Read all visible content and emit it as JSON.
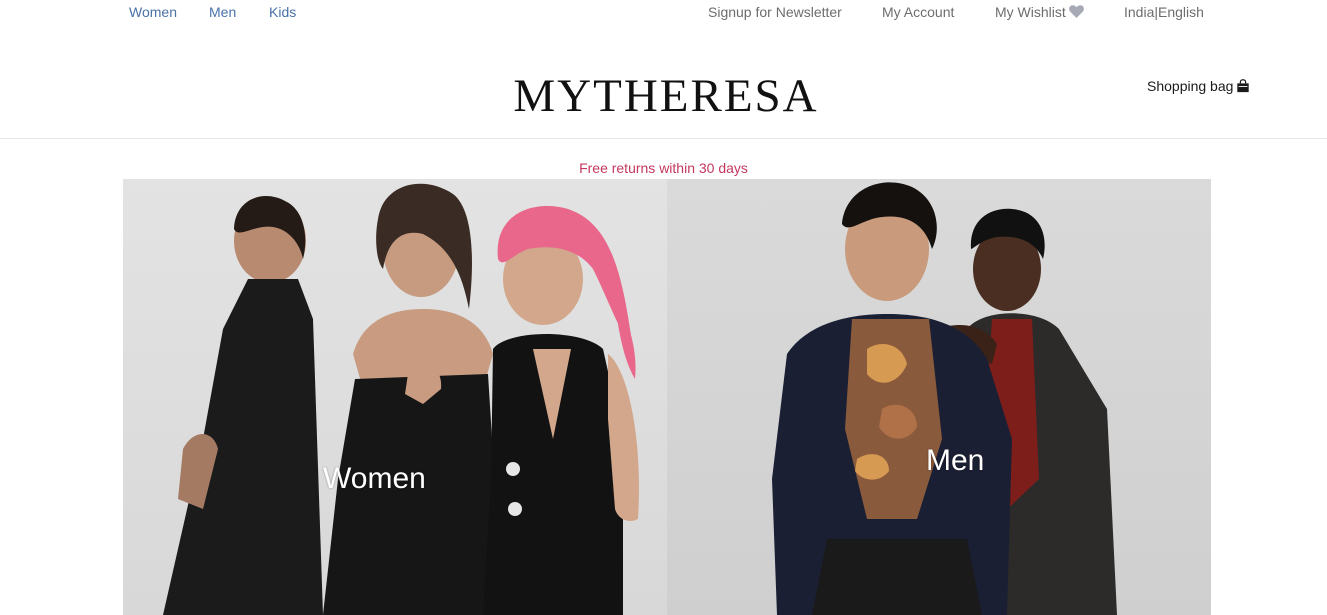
{
  "top_nav": {
    "departments": [
      "Women",
      "Men",
      "Kids"
    ],
    "newsletter": "Signup for Newsletter",
    "account": "My Account",
    "wishlist": "My Wishlist",
    "language": "India|English"
  },
  "header": {
    "logo": "MYTHERESA",
    "shopping_bag": "Shopping bag"
  },
  "promo": {
    "text": "Free returns within 30 days"
  },
  "hero": {
    "tiles": [
      {
        "label": "Women"
      },
      {
        "label": "Men"
      }
    ]
  },
  "icons": {
    "wishlist": "heart-icon",
    "bag": "shopping-bag-icon"
  },
  "colors": {
    "department_link": "#4a72a8",
    "utility_link": "#6d6d6d",
    "promo_text": "#c4385f",
    "logo": "#111111"
  }
}
